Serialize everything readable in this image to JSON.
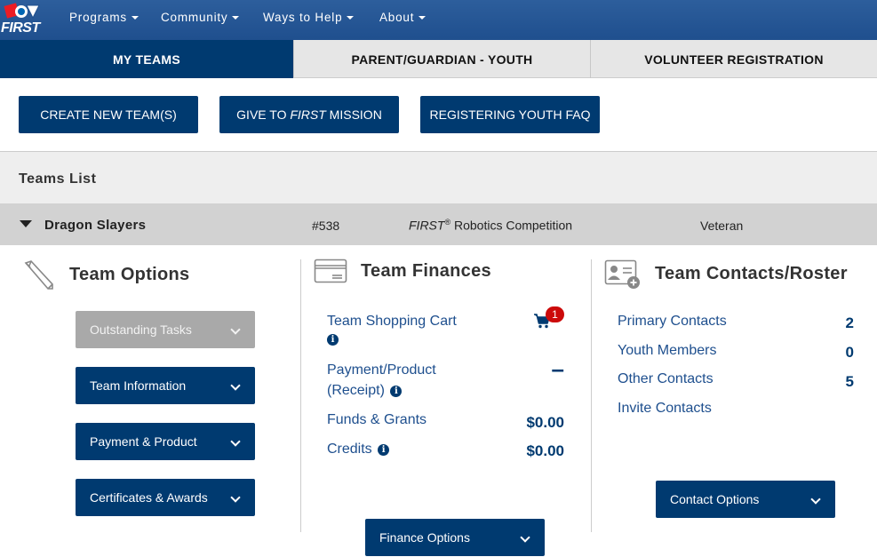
{
  "brand": {
    "logo_text": "FIRST"
  },
  "nav": [
    {
      "label": "Programs"
    },
    {
      "label": "Community"
    },
    {
      "label": "Ways to Help"
    },
    {
      "label": "About"
    }
  ],
  "tabs": [
    {
      "label": "MY TEAMS",
      "active": true
    },
    {
      "label": "PARENT/GUARDIAN - YOUTH",
      "active": false
    },
    {
      "label": "VOLUNTEER REGISTRATION",
      "active": false
    }
  ],
  "actions": {
    "create": "CREATE NEW TEAM(S)",
    "give_prefix": "GIVE TO ",
    "give_first": "FIRST",
    "give_suffix": " MISSION",
    "faq": "REGISTERING YOUTH FAQ"
  },
  "teams_list": {
    "title": "Teams List"
  },
  "team": {
    "name": "Dragon Slayers",
    "number": "#538",
    "program_first": "FIRST",
    "program_reg": "®",
    "program_rest": " Robotics Competition",
    "status": "Veteran"
  },
  "team_options": {
    "title": "Team Options",
    "items": [
      {
        "label": "Outstanding Tasks",
        "disabled": true
      },
      {
        "label": "Team Information",
        "disabled": false
      },
      {
        "label": "Payment & Product",
        "disabled": false
      },
      {
        "label": "Certificates & Awards",
        "disabled": false
      }
    ]
  },
  "team_finances": {
    "title": "Team Finances",
    "shopping_cart_label": "Team Shopping Cart",
    "cart_count": "1",
    "payment_label_1": "Payment/Product",
    "payment_label_2": "(Receipt)",
    "payment_value": "–",
    "funds_label": "Funds & Grants",
    "funds_value": "$0.00",
    "credits_label": "Credits",
    "credits_value": "$0.00",
    "options_label": "Finance Options"
  },
  "team_contacts": {
    "title": "Team Contacts/Roster",
    "primary_label": "Primary Contacts",
    "primary_count": "2",
    "youth_label": "Youth Members",
    "youth_count": "0",
    "other_label": "Other Contacts",
    "other_count": "5",
    "invite_label": "Invite Contacts",
    "options_label": "Contact Options"
  },
  "colors": {
    "primary": "#003a70",
    "header": "#1f4f8e",
    "badge": "#cc0a0a"
  }
}
